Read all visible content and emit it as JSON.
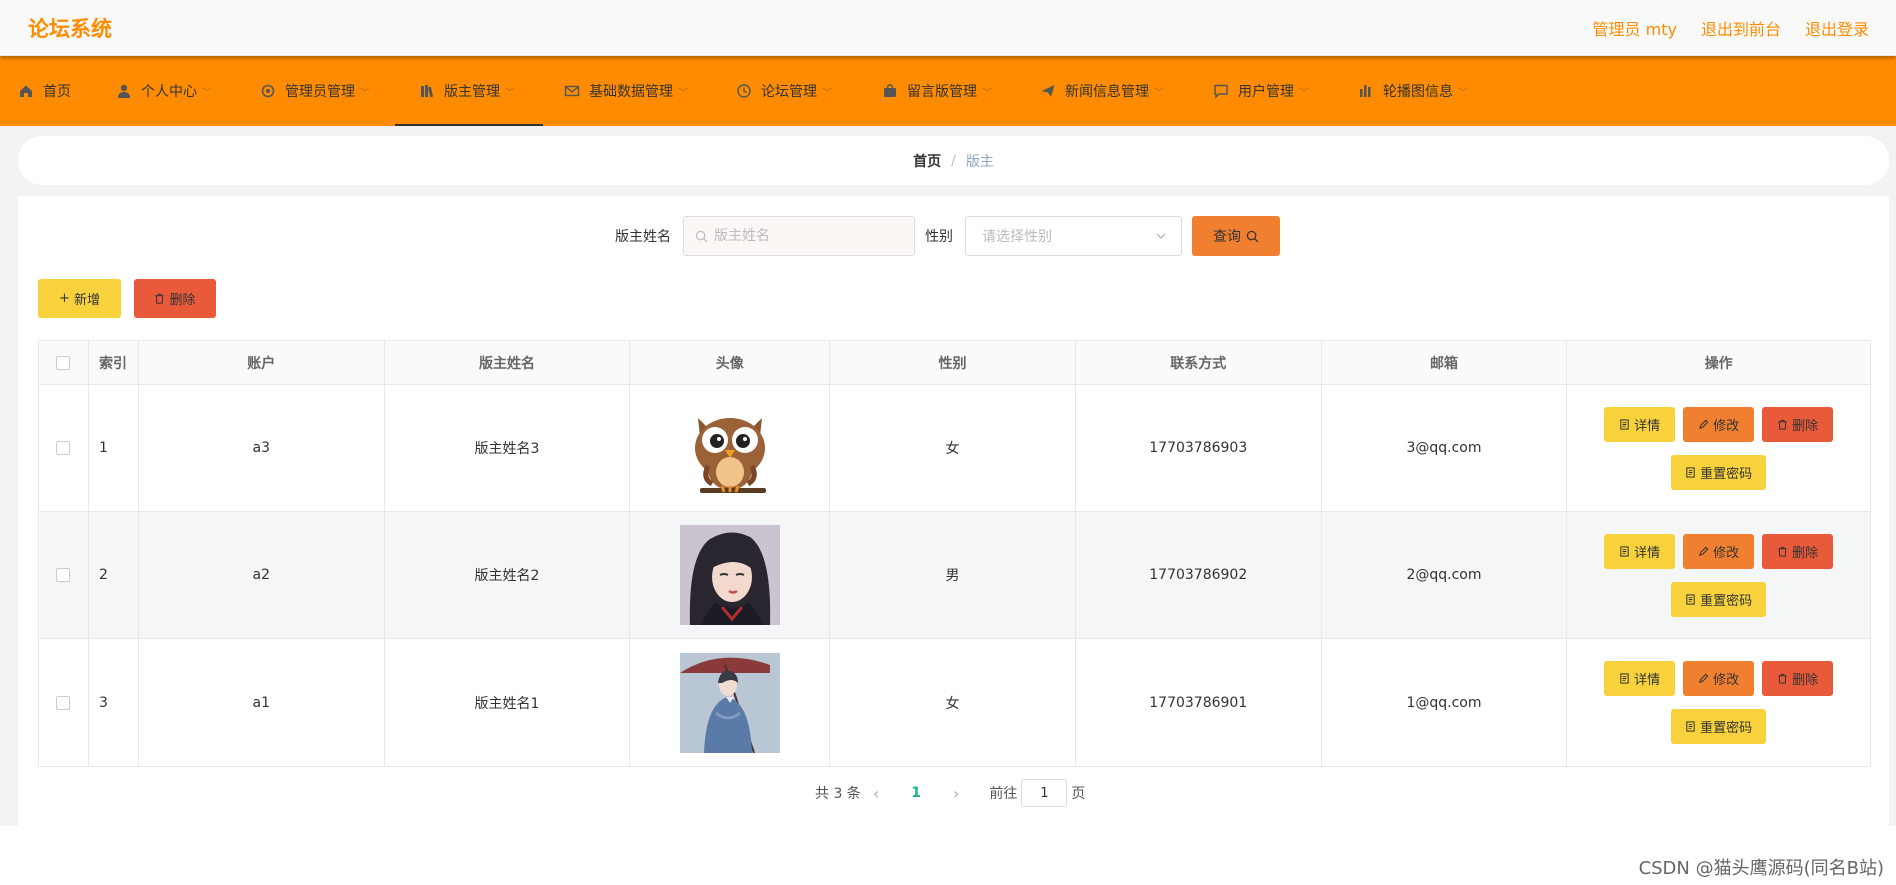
{
  "header": {
    "logo": "论坛系统",
    "links": [
      "管理员 mty",
      "退出到前台",
      "退出登录"
    ]
  },
  "nav": [
    {
      "label": "首页",
      "icon": "home-icon"
    },
    {
      "label": "个人中心",
      "icon": "user-icon"
    },
    {
      "label": "管理员管理",
      "icon": "gear-icon"
    },
    {
      "label": "版主管理",
      "icon": "books-icon"
    },
    {
      "label": "基础数据管理",
      "icon": "mail-icon"
    },
    {
      "label": "论坛管理",
      "icon": "clock-icon"
    },
    {
      "label": "留言版管理",
      "icon": "bag-icon"
    },
    {
      "label": "新闻信息管理",
      "icon": "send-icon"
    },
    {
      "label": "用户管理",
      "icon": "chat-icon"
    },
    {
      "label": "轮播图信息",
      "icon": "chart-icon"
    }
  ],
  "breadcrumb": {
    "home": "首页",
    "separator": "/",
    "current": "版主"
  },
  "search": {
    "name_label": "版主姓名",
    "name_placeholder": "版主姓名",
    "gender_label": "性别",
    "gender_placeholder": "请选择性别",
    "query_button": "查询"
  },
  "actions": {
    "add": "新增",
    "delete": "删除"
  },
  "table": {
    "headers": [
      "索引",
      "账户",
      "版主姓名",
      "头像",
      "性别",
      "联系方式",
      "邮箱",
      "操作"
    ],
    "rows": [
      {
        "index": "1",
        "account": "a3",
        "name": "版主姓名3",
        "avatar": "owl-cartoon-avatar",
        "gender": "女",
        "phone": "17703786903",
        "email": "3@qq.com"
      },
      {
        "index": "2",
        "account": "a2",
        "name": "版主姓名2",
        "avatar": "girl-portrait-avatar",
        "gender": "男",
        "phone": "17703786902",
        "email": "2@qq.com"
      },
      {
        "index": "3",
        "account": "a1",
        "name": "版主姓名1",
        "avatar": "umbrella-painting-avatar",
        "gender": "女",
        "phone": "17703786901",
        "email": "1@qq.com"
      }
    ],
    "row_buttons": {
      "detail": "详情",
      "edit": "修改",
      "remove": "删除",
      "reset": "重置密码"
    }
  },
  "pagination": {
    "total_text": "共 3 条",
    "current_page": "1",
    "goto_label": "前往",
    "goto_value": "1",
    "page_suffix": "页"
  },
  "watermark": "CSDN @猫头鹰源码(同名B站)",
  "colors": {
    "accent": "#ff8c00",
    "yellow": "#f7d23d",
    "orange": "#f08030",
    "red": "#e95a3a",
    "page_active": "#1fb28a"
  }
}
